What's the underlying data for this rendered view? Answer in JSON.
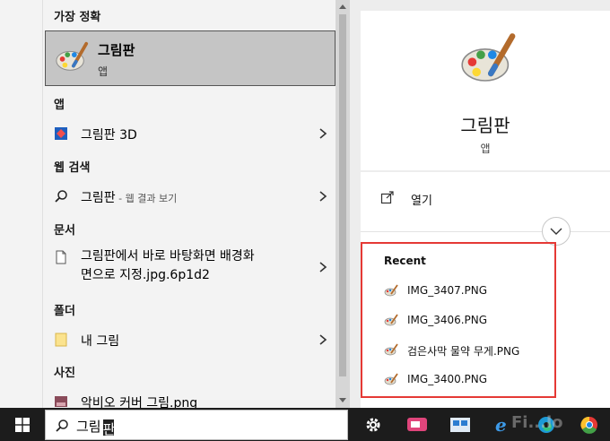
{
  "results": {
    "best_match": {
      "heading": "가장 정확",
      "title": "그림판",
      "subtitle": "앱"
    },
    "apps": {
      "heading": "앱",
      "item": "그림판 3D"
    },
    "web": {
      "heading": "웹 검색",
      "query": "그림판",
      "suffix": " - 웹 결과 보기"
    },
    "documents": {
      "heading": "문서",
      "line1": "그림판에서 바로 바탕화면 배경화",
      "line2": "면으로 지정.jpg.6p1d2"
    },
    "folders": {
      "heading": "폴더",
      "item": "내 그림"
    },
    "photos": {
      "heading": "사진",
      "item": "악비오 커버 그림.png"
    }
  },
  "preview": {
    "title": "그림판",
    "subtitle": "앱",
    "open_label": "열기",
    "recent_heading": "Recent",
    "recent_items": [
      "IMG_3407.PNG",
      "IMG_3406.PNG",
      "검은사막 물약 무게.PNG",
      "IMG_3400.PNG"
    ]
  },
  "taskbar": {
    "search_text": "그림",
    "search_caret_char": "판",
    "watermark": "Fi...lo"
  },
  "colors": {
    "highlight_border": "#e53935",
    "selected_bg": "#c5c5c5",
    "taskbar_bg": "#1c1c1c"
  },
  "icons": [
    "paint-icon",
    "paint3d-icon",
    "search-icon",
    "document-icon",
    "folder-icon",
    "photo-icon",
    "chevron-right-icon",
    "open-icon",
    "chevron-down-icon",
    "windows-logo-icon",
    "settings-icon",
    "app-icon",
    "edge-icon",
    "chrome-icon"
  ]
}
